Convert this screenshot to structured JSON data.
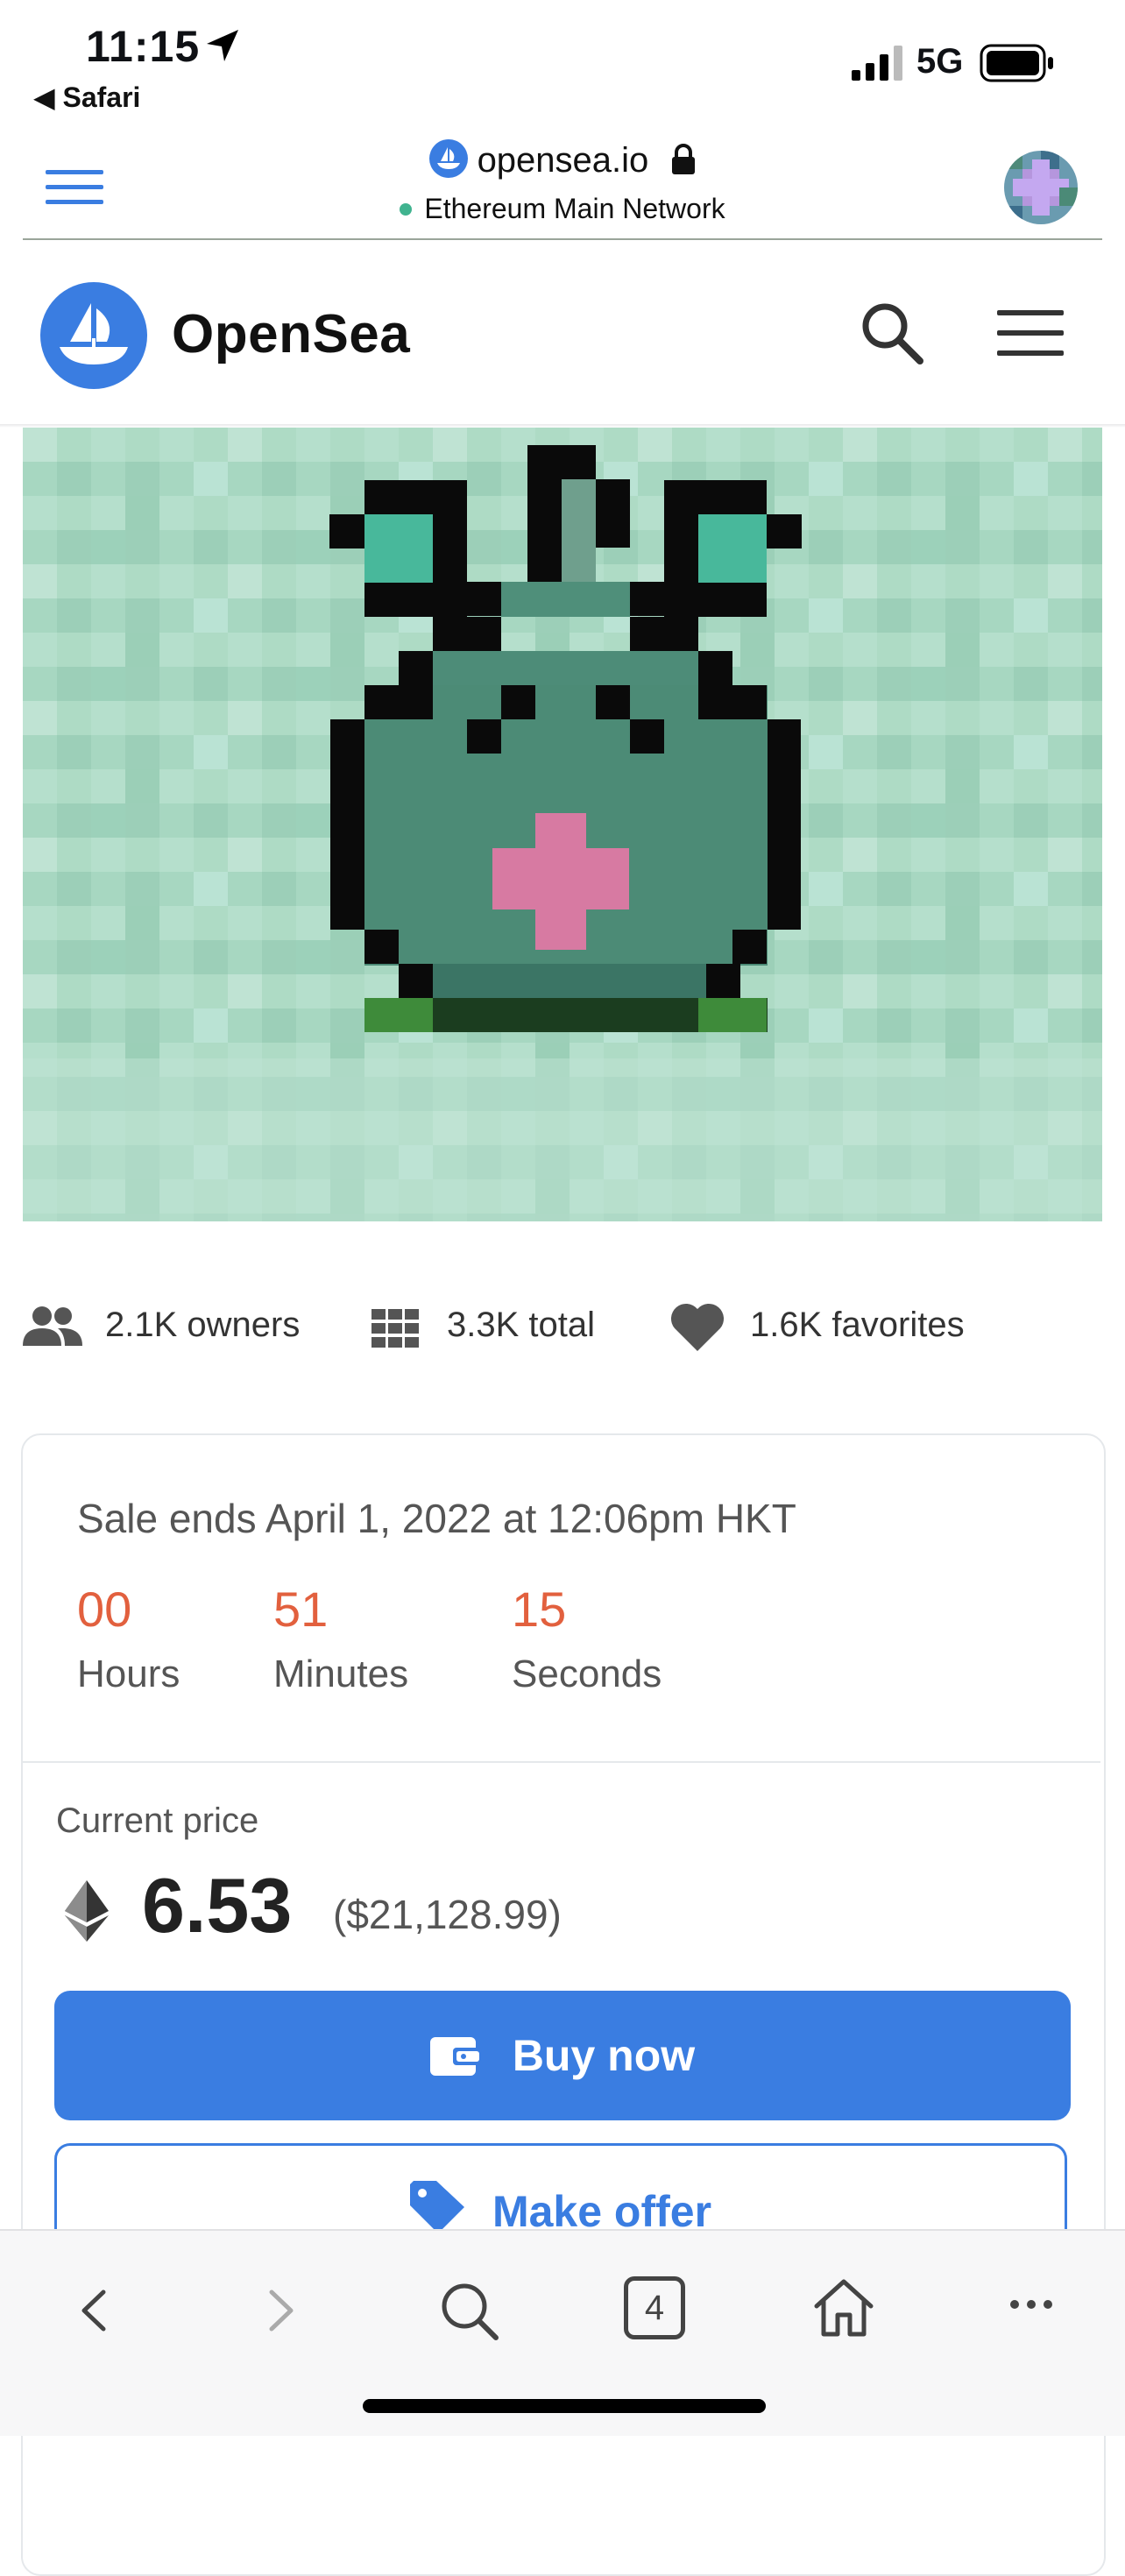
{
  "status_bar": {
    "time": "11:15",
    "back_app": "Safari",
    "network": "5G"
  },
  "browser": {
    "domain": "opensea.io",
    "network_name": "Ethereum Main Network"
  },
  "header": {
    "brand": "OpenSea"
  },
  "stats": {
    "owners": "2.1K owners",
    "total": "3.3K total",
    "favorites": "1.6K favorites"
  },
  "sale": {
    "ends_text": "Sale ends April 1, 2022 at 12:06pm HKT",
    "hours": "00",
    "hours_label": "Hours",
    "minutes": "51",
    "minutes_label": "Minutes",
    "seconds": "15",
    "seconds_label": "Seconds"
  },
  "price": {
    "label": "Current price",
    "eth": "6.53",
    "usd": "($21,128.99)"
  },
  "buttons": {
    "buy_now": "Buy now",
    "make_offer": "Make offer"
  },
  "toolbar": {
    "tabs_count": "4"
  },
  "colors": {
    "accent": "#3a7de1",
    "countdown": "#e2603e"
  }
}
